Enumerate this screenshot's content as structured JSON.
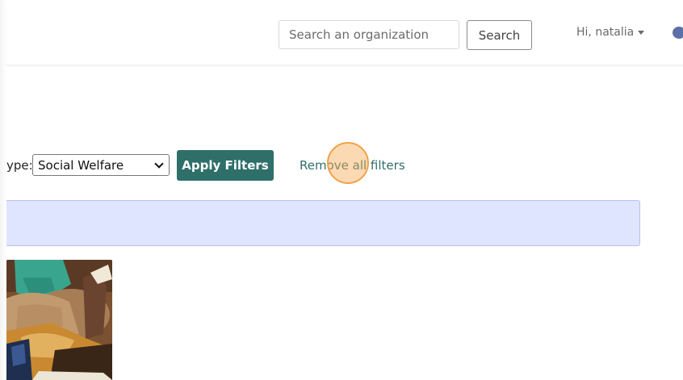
{
  "header": {
    "search_placeholder": "Search an organization",
    "search_button": "Search",
    "user_greeting": "Hi, natalia"
  },
  "filters": {
    "type_label_partial": "ype:",
    "selected_type": "Social Welfare",
    "apply_button": "Apply Filters",
    "remove_link": "Remove all filters"
  },
  "colors": {
    "primary": "#2f6f6a",
    "alert_bg": "#dfe5ff",
    "click_marker": "#f7ab56"
  },
  "icons": {
    "chat": "chat-bubble-icon",
    "caret": "caret-down-icon",
    "select_chevron": "chevron-down-icon"
  }
}
